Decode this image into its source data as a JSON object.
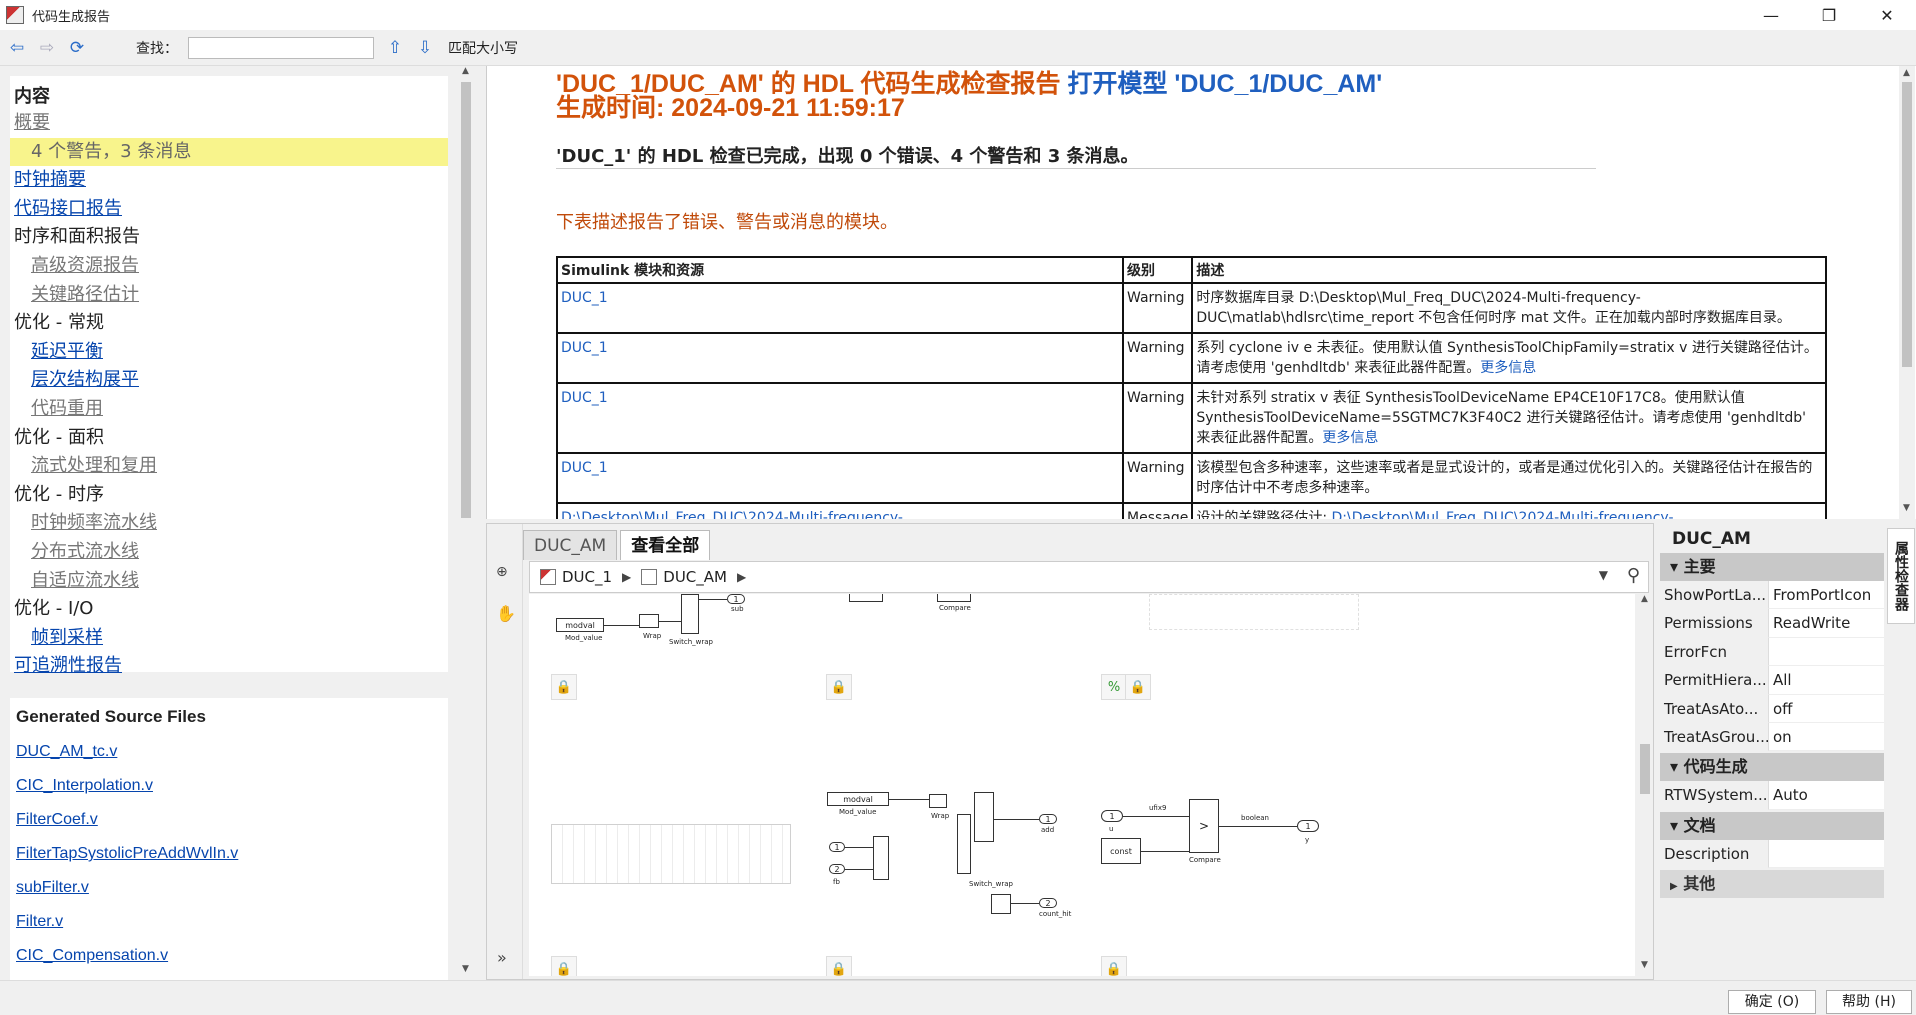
{
  "window": {
    "title": "代码生成报告",
    "min": "—",
    "max": "❐",
    "close": "✕"
  },
  "toolbar": {
    "find_label": "查找：",
    "find_value": "",
    "match_case": "匹配大小写"
  },
  "toc": {
    "title": "内容",
    "items": [
      {
        "label": "概要",
        "style": "gray"
      },
      {
        "label": "4 个警告，3 条消息",
        "style": "hl"
      },
      {
        "label": "时钟摘要",
        "style": "link"
      },
      {
        "label": "代码接口报告",
        "style": "link"
      },
      {
        "label": "时序和面积报告",
        "style": "plain"
      },
      {
        "label": "高级资源报告",
        "style": "gray indent"
      },
      {
        "label": "关键路径估计",
        "style": "gray indent"
      },
      {
        "label": "优化 - 常规",
        "style": "plain"
      },
      {
        "label": "延迟平衡",
        "style": "link indent"
      },
      {
        "label": "层次结构展平",
        "style": "link indent"
      },
      {
        "label": "代码重用",
        "style": "gray indent"
      },
      {
        "label": "优化 - 面积",
        "style": "plain"
      },
      {
        "label": "流式处理和复用",
        "style": "gray indent"
      },
      {
        "label": "优化 - 时序",
        "style": "plain"
      },
      {
        "label": "时钟频率流水线",
        "style": "gray indent"
      },
      {
        "label": "分布式流水线",
        "style": "gray indent"
      },
      {
        "label": "自适应流水线",
        "style": "gray indent"
      },
      {
        "label": "优化 - I/O",
        "style": "plain"
      },
      {
        "label": "帧到采样",
        "style": "link indent"
      },
      {
        "label": "可追溯性报告",
        "style": "link"
      }
    ]
  },
  "files": {
    "title": "Generated Source Files",
    "items": [
      "DUC_AM_tc.v",
      "CIC_Interpolation.v",
      "FilterCoef.v",
      "FilterTapSystolicPreAddWvlIn.v",
      "subFilter.v",
      "Filter.v",
      "CIC_Compensation.v"
    ]
  },
  "report": {
    "title_prefix": "'DUC_1/DUC_AM' 的 HDL 代码生成检查报告",
    "title_link": "打开模型 'DUC_1/DUC_AM'",
    "time": "生成时间: 2024-09-21 11:59:17",
    "summary": "'DUC_1' 的 HDL 检查已完成，出现 0 个错误、4 个警告和 3 条消息。",
    "desc": "下表描述报告了错误、警告或消息的模块。",
    "headers": [
      "Simulink 模块和资源",
      "级别",
      "描述"
    ],
    "rows": [
      {
        "block": "DUC_1",
        "level": "Warning",
        "desc": "时序数据库目录 D:\\Desktop\\Mul_Freq_DUC\\2024-Multi-frequency-DUC\\matlab\\hdlsrc\\time_report 不包含任何时序 mat 文件。正在加载内部时序数据库目录。",
        "more": ""
      },
      {
        "block": "DUC_1",
        "level": "Warning",
        "desc": "系列 cyclone iv e 未表征。使用默认值 SynthesisToolChipFamily=stratix v 进行关键路径估计。请考虑使用 'genhdltdb' 来表征此器件配置。",
        "more": "更多信息"
      },
      {
        "block": "DUC_1",
        "level": "Warning",
        "desc": "未针对系列 stratix v 表征 SynthesisToolDeviceName EP4CE10F17C8。使用默认值 SynthesisToolDeviceName=5SGTMC7K3F40C2 进行关键路径估计。请考虑使用 'genhdltdb' 来表征此器件配置。",
        "more": "更多信息"
      },
      {
        "block": "DUC_1",
        "level": "Warning",
        "desc": "该模型包含多种速率，这些速率或者是显式设计的，或者是通过优化引入的。关键路径估计在报告的时序估计中不考虑多种速率。",
        "more": ""
      },
      {
        "block": "D:\\Desktop\\Mul_Freq_DUC\\2024-Multi-frequency-",
        "level": "Message",
        "desc": "设计的关键路径估计: ",
        "more": "D:\\Desktop\\Mul_Freq_DUC\\2024-Multi-frequency-"
      }
    ]
  },
  "model": {
    "tabs": [
      "DUC_AM",
      "查看全部"
    ],
    "breadcrumb": [
      "DUC_1",
      "DUC_AM"
    ],
    "labels": {
      "modval": "modval",
      "mod_value": "Mod_value",
      "wrap": "Wrap",
      "switch_wrap": "Switch_wrap",
      "compare": "Compare",
      "add": "add",
      "sub": "sub",
      "const": "const",
      "boolean": "boolean",
      "y": "y",
      "u": "u",
      "count_hit": "count_hit",
      "fb": "fb",
      "ufix9": "ufix9",
      "uint8": "uint8",
      "in1": "1",
      "in2": "2",
      "gt": ">"
    }
  },
  "props": {
    "title": "DUC_AM",
    "side_tab": "属性检查器",
    "sections": [
      {
        "name": "主要",
        "rows": [
          {
            "k": "ShowPortLa...",
            "v": "FromPortIcon"
          },
          {
            "k": "Permissions",
            "v": "ReadWrite"
          },
          {
            "k": "ErrorFcn",
            "v": ""
          },
          {
            "k": "PermitHiera...",
            "v": "All"
          },
          {
            "k": "TreatAsAto...",
            "v": "off"
          },
          {
            "k": "TreatAsGrou...",
            "v": "on"
          }
        ]
      },
      {
        "name": "代码生成",
        "rows": [
          {
            "k": "RTWSystem...",
            "v": "Auto"
          }
        ]
      },
      {
        "name": "文档",
        "rows": [
          {
            "k": "Description",
            "v": ""
          }
        ]
      }
    ],
    "collapsed_section": "其他"
  },
  "buttons": {
    "ok": "确定 (O)",
    "help": "帮助 (H)"
  }
}
